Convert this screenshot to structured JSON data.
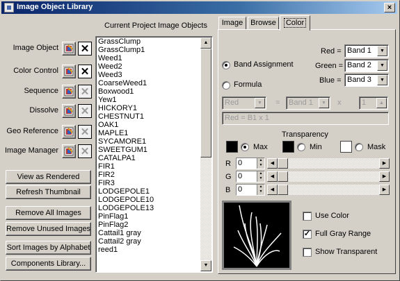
{
  "window": {
    "title": "Image Object Library",
    "close_label": "×"
  },
  "list": {
    "header": "Current Project Image Objects",
    "items": [
      "GrassClump",
      "GrassClump1",
      "Weed1",
      "Weed2",
      "Weed3",
      "CoarseWeed1",
      "Boxwood1",
      "Yew1",
      "HICKORY1",
      "CHESTNUT1",
      "OAK1",
      "MAPLE1",
      "SYCAMORE1",
      "SWEETGUM1",
      "CATALPA1",
      "FIR1",
      "FIR2",
      "FIR3",
      "LODGEPOLE1",
      "LODGEPOLE10",
      "LODGEPOLE13",
      "PinFlag1",
      "PinFlag2",
      "Cattail1 gray",
      "Cattail2 gray",
      "reed1"
    ]
  },
  "left": {
    "rows": [
      {
        "label": "Image Object",
        "edit_icon": "edit-icon",
        "x_state": "enabled"
      },
      {
        "label": "Color Control",
        "edit_icon": "edit-icon",
        "x_state": "enabled"
      },
      {
        "label": "Sequence",
        "edit_icon": "edit-icon",
        "x_state": "disabled"
      },
      {
        "label": "Dissolve",
        "edit_icon": "edit-icon",
        "x_state": "disabled"
      },
      {
        "label": "Geo Reference",
        "edit_icon": "edit-icon",
        "x_state": "disabled"
      },
      {
        "label": "Image Manager",
        "edit_icon": "edit-icon",
        "x_state": "disabled"
      }
    ],
    "x_label": "✕",
    "buttons": {
      "view_rendered": "View as Rendered",
      "refresh": "Refresh Thumbnail",
      "remove_all": "Remove All Images",
      "remove_unused": "Remove Unused Images",
      "sort": "Sort Images by Alphabet",
      "components": "Components Library..."
    }
  },
  "tabs": {
    "image": "Image",
    "browse": "Browse",
    "color": "Color",
    "active": "Color"
  },
  "color": {
    "band_assignment": "Band Assignment",
    "formula": "Formula",
    "red_label": "Red =",
    "green_label": "Green =",
    "blue_label": "Blue =",
    "red_value": "Band 1",
    "green_value": "Band 2",
    "blue_value": "Band 3",
    "formula_channel": "Red",
    "equals": "=",
    "formula_band": "Band 1",
    "times": "x",
    "formula_mult": "1",
    "formula_text": "Red = B1 x 1",
    "transparency": "Transparency",
    "max": "Max",
    "min": "Min",
    "mask": "Mask",
    "r_label": "R",
    "g_label": "G",
    "b_label": "B",
    "r_value": "0",
    "g_value": "0",
    "b_value": "0",
    "use_color": "Use Color",
    "full_gray": "Full Gray Range",
    "show_transparent": "Show Transparent",
    "check_mark": "✓"
  }
}
